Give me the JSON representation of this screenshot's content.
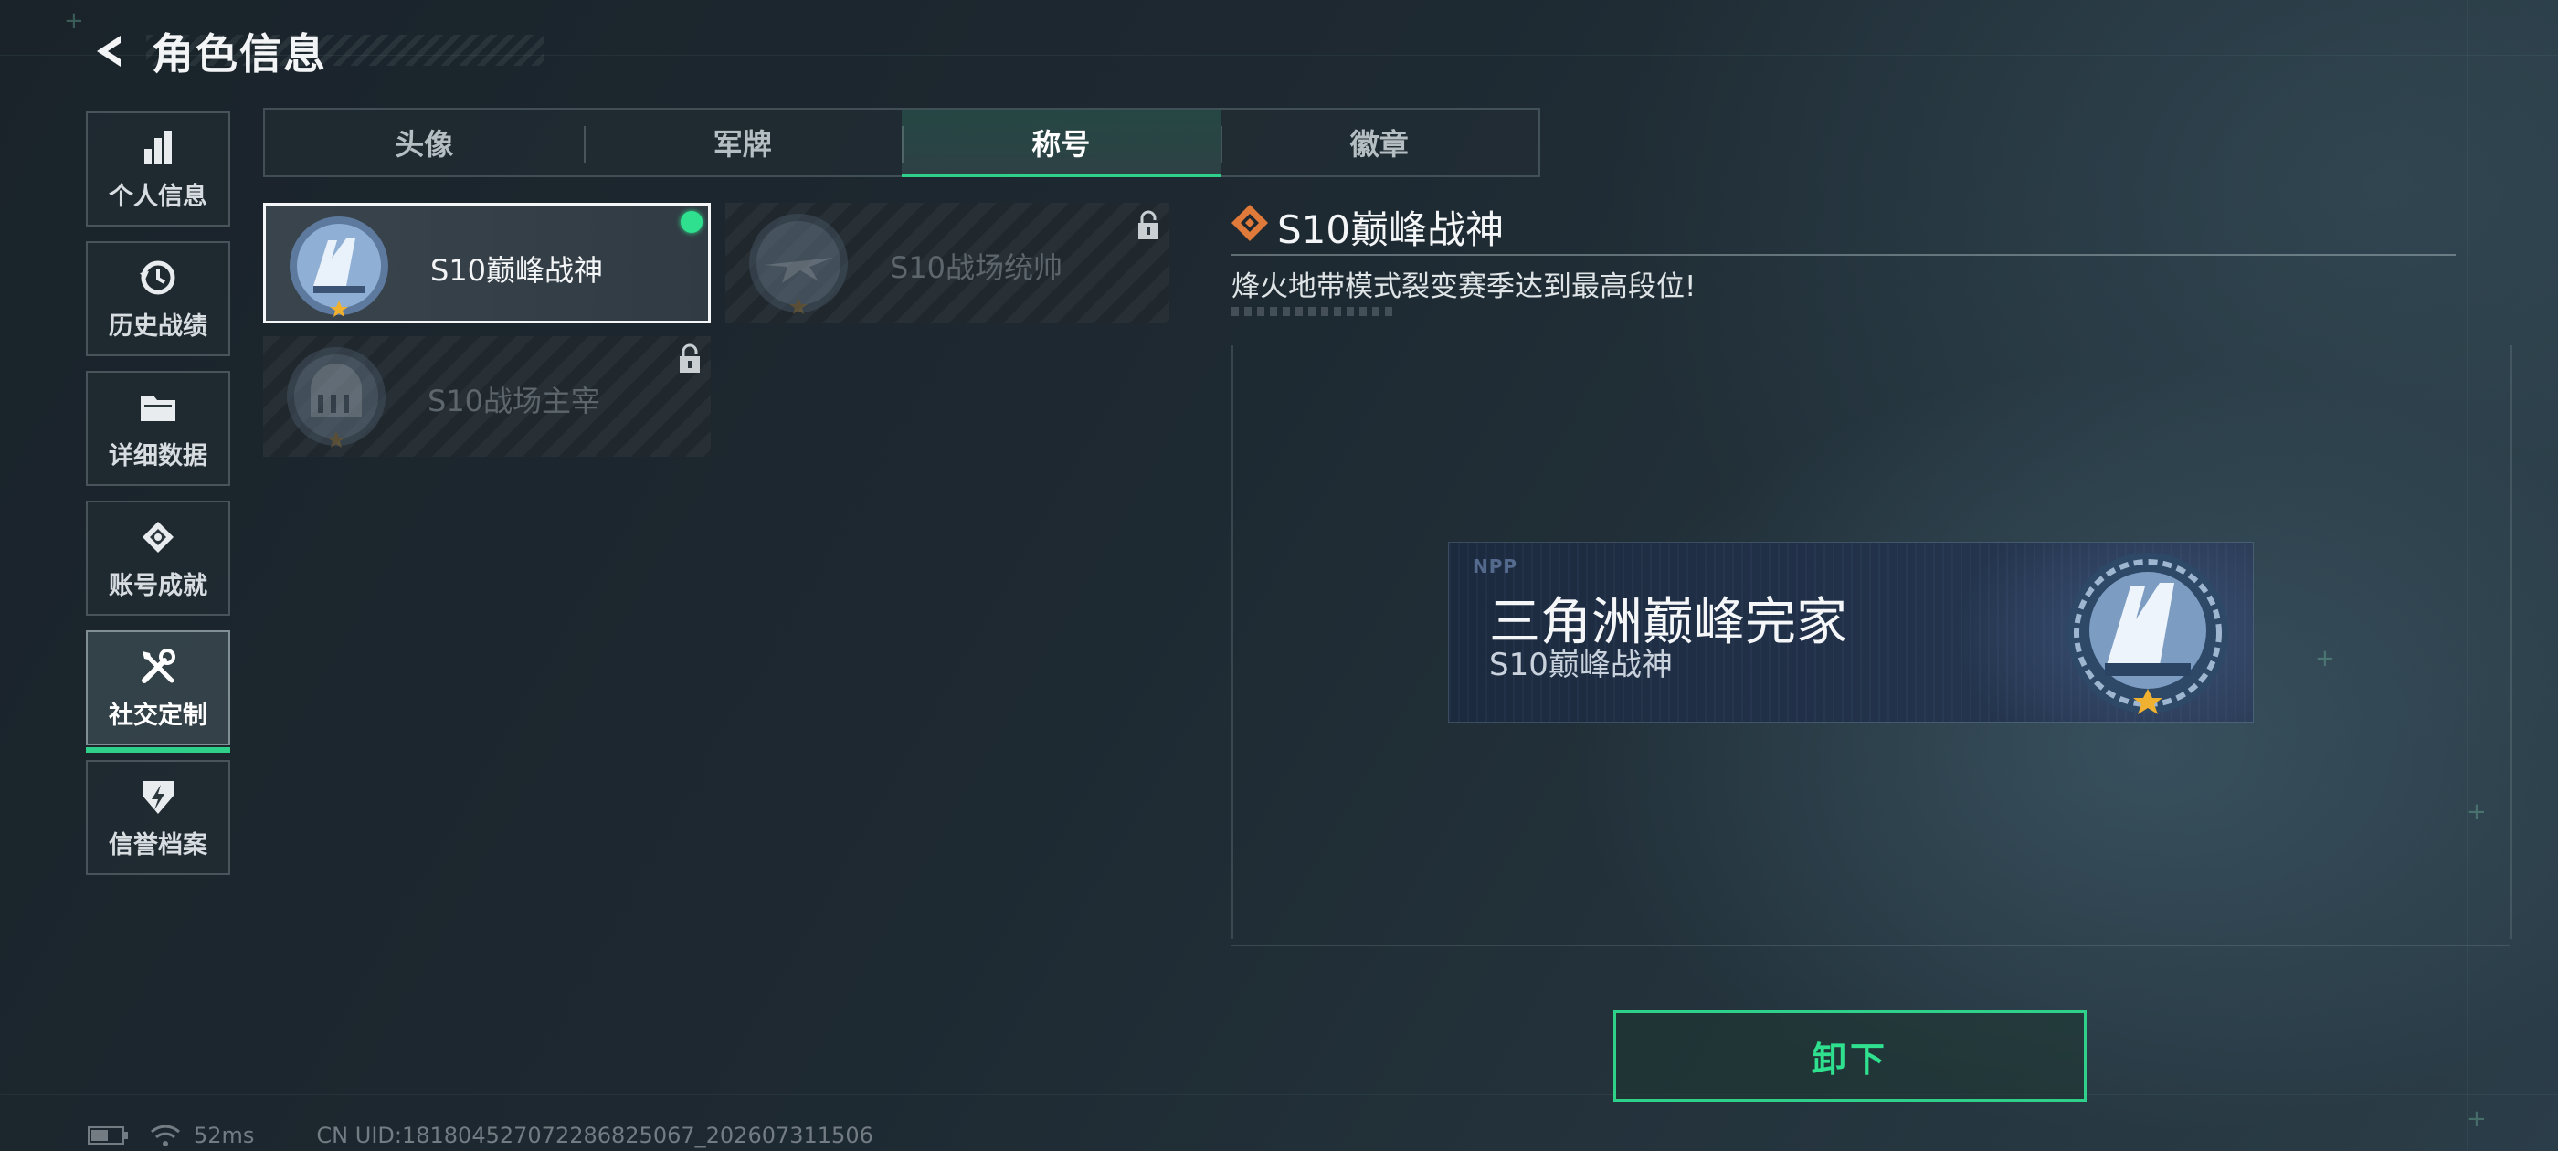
{
  "header": {
    "title": "角色信息",
    "back_icon": "back-arrow-icon"
  },
  "sidebar": {
    "items": [
      {
        "label": "个人信息",
        "icon": "bar-chart-icon",
        "active": false
      },
      {
        "label": "历史战绩",
        "icon": "history-clock-icon",
        "active": false
      },
      {
        "label": "详细数据",
        "icon": "folder-icon",
        "active": false
      },
      {
        "label": "账号成就",
        "icon": "achievement-icon",
        "active": false
      },
      {
        "label": "社交定制",
        "icon": "wrench-screwdriver-icon",
        "active": true
      },
      {
        "label": "信誉档案",
        "icon": "credit-badge-icon",
        "active": false
      }
    ]
  },
  "tabs": [
    {
      "label": "头像",
      "active": false
    },
    {
      "label": "军牌",
      "active": false
    },
    {
      "label": "称号",
      "active": true
    },
    {
      "label": "徽章",
      "active": false
    }
  ],
  "titles": [
    {
      "name": "S10巅峰战神",
      "selected": true,
      "equipped": true,
      "locked": false
    },
    {
      "name": "S10战场统帅",
      "selected": false,
      "equipped": false,
      "locked": true
    },
    {
      "name": "S10战场主宰",
      "selected": false,
      "equipped": false,
      "locked": true
    }
  ],
  "detail": {
    "title": "S10巅峰战神",
    "description": "烽火地带模式裂变赛季达到最高段位!",
    "nameplate": {
      "logo": "NPP",
      "player_name": "三角洲巅峰完家",
      "title": "S10巅峰战神"
    },
    "unequip_label": "卸下"
  },
  "status": {
    "ping": "52ms",
    "uid": "CN UID:18180452707228682506​7_202607311506"
  },
  "colors": {
    "accent": "#2fd08a",
    "diamond": "#e07a3a",
    "star": "#f0b030"
  }
}
